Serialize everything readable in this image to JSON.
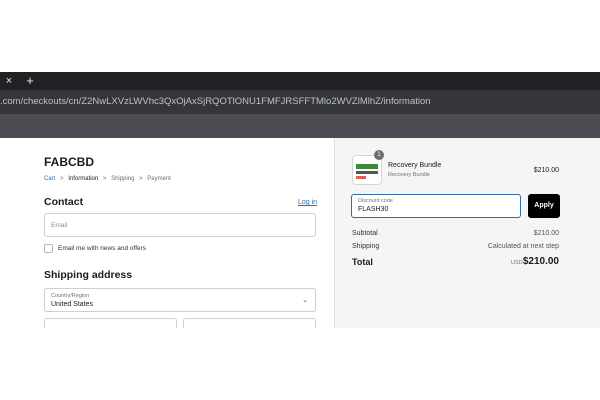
{
  "browser": {
    "tab_close": "×",
    "new_tab": "+",
    "url": ".com/checkouts/cn/Z2NwLXVzLWVhc3QxOjAxSjRQOTlONU1FMFJRSFFTMlo2WVZlMlhZ/information"
  },
  "store": {
    "name": "FABCBD"
  },
  "breadcrumbs": {
    "cart": "Cart",
    "information": "Information",
    "shipping": "Shipping",
    "payment": "Payment",
    "separator": ">"
  },
  "contact": {
    "heading": "Contact",
    "login_link": "Log in",
    "email_placeholder": "Email",
    "newsletter_label": "Email me with news and offers"
  },
  "shipping": {
    "heading": "Shipping address",
    "country_label": "Country/Region",
    "country_value": "United States",
    "chevron": "⌄"
  },
  "summary": {
    "item": {
      "quantity": "1",
      "name": "Recovery Bundle",
      "variant": "Recovery Bundle",
      "price": "$210.00"
    },
    "discount": {
      "label": "Discount code",
      "value": "FLASH30",
      "apply_label": "Apply"
    },
    "subtotal_label": "Subtotal",
    "subtotal_value": "$210.00",
    "shipping_label": "Shipping",
    "shipping_value": "Calculated at next step",
    "total_label": "Total",
    "currency": "USD",
    "total_value": "$210.00"
  },
  "colors": {
    "link": "#2f6ea8",
    "apply_bg": "#000000",
    "focus_border": "#2f6ea8"
  }
}
